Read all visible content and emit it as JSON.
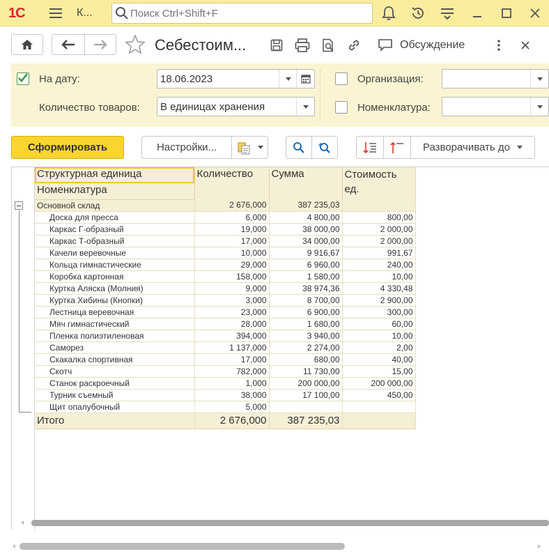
{
  "window": {
    "app_short": "К...",
    "search_placeholder": "Поиск Ctrl+Shift+F",
    "icons": [
      "1c-logo",
      "menu-icon",
      "search-icon",
      "bell-icon",
      "history-icon",
      "functions-icon",
      "minimize-icon",
      "maximize-icon",
      "close-icon"
    ]
  },
  "form": {
    "title": "Себестоим...",
    "discussion_label": "Обсуждение"
  },
  "filters": {
    "date_label": "На дату:",
    "date_checked": true,
    "date_value": "18.06.2023",
    "quantity_label": "Количество товаров:",
    "quantity_value": "В единицах хранения",
    "org_label": "Организация:",
    "org_checked": false,
    "org_value": "",
    "nomenclature_label": "Номенклатура:",
    "nomenclature_checked": false,
    "nomenclature_value": ""
  },
  "commands": {
    "generate": "Сформировать",
    "settings": "Настройки...",
    "expand_to": "Разворачивать до"
  },
  "report": {
    "headers": {
      "structure": "Структурная единица",
      "nomenclature": "Номенклатура",
      "quantity": "Количество",
      "sum": "Сумма",
      "unit_cost": "Стоимость ед."
    },
    "group": {
      "name": "Основной склад",
      "quantity": "2 676,000",
      "sum": "387 235,03",
      "unit_cost": ""
    },
    "rows": [
      {
        "name": "Доска для пресса",
        "quantity": "6,000",
        "sum": "4 800,00",
        "unit_cost": "800,00"
      },
      {
        "name": "Каркас Г-образный",
        "quantity": "19,000",
        "sum": "38 000,00",
        "unit_cost": "2 000,00"
      },
      {
        "name": "Каркас Т-образный",
        "quantity": "17,000",
        "sum": "34 000,00",
        "unit_cost": "2 000,00"
      },
      {
        "name": "Качели веревочные",
        "quantity": "10,000",
        "sum": "9 916,67",
        "unit_cost": "991,67"
      },
      {
        "name": "Кольца гимнастические",
        "quantity": "29,000",
        "sum": "6 960,00",
        "unit_cost": "240,00"
      },
      {
        "name": "Коробка картонная",
        "quantity": "158,000",
        "sum": "1 580,00",
        "unit_cost": "10,00"
      },
      {
        "name": "Куртка Аляска (Молния)",
        "quantity": "9,000",
        "sum": "38 974,36",
        "unit_cost": "4 330,48"
      },
      {
        "name": "Куртка Хибины (Кнопки)",
        "quantity": "3,000",
        "sum": "8 700,00",
        "unit_cost": "2 900,00"
      },
      {
        "name": "Лестница веревочная",
        "quantity": "23,000",
        "sum": "6 900,00",
        "unit_cost": "300,00"
      },
      {
        "name": "Мяч гимнастический",
        "quantity": "28,000",
        "sum": "1 680,00",
        "unit_cost": "60,00"
      },
      {
        "name": "Пленка полиэтиленовая",
        "quantity": "394,000",
        "sum": "3 940,00",
        "unit_cost": "10,00"
      },
      {
        "name": "Саморез",
        "quantity": "1 137,000",
        "sum": "2 274,00",
        "unit_cost": "2,00"
      },
      {
        "name": "Скакалка спортивная",
        "quantity": "17,000",
        "sum": "680,00",
        "unit_cost": "40,00"
      },
      {
        "name": "Скотч",
        "quantity": "782,000",
        "sum": "11 730,00",
        "unit_cost": "15,00"
      },
      {
        "name": "Станок раскроечный",
        "quantity": "1,000",
        "sum": "200 000,00",
        "unit_cost": "200 000,00"
      },
      {
        "name": "Турник съемный",
        "quantity": "38,000",
        "sum": "17 100,00",
        "unit_cost": "450,00"
      },
      {
        "name": "Щит опалубочный",
        "quantity": "5,000",
        "sum": "",
        "unit_cost": ""
      }
    ],
    "total": {
      "label": "Итого",
      "quantity": "2 676,000",
      "sum": "387 235,03",
      "unit_cost": ""
    }
  }
}
